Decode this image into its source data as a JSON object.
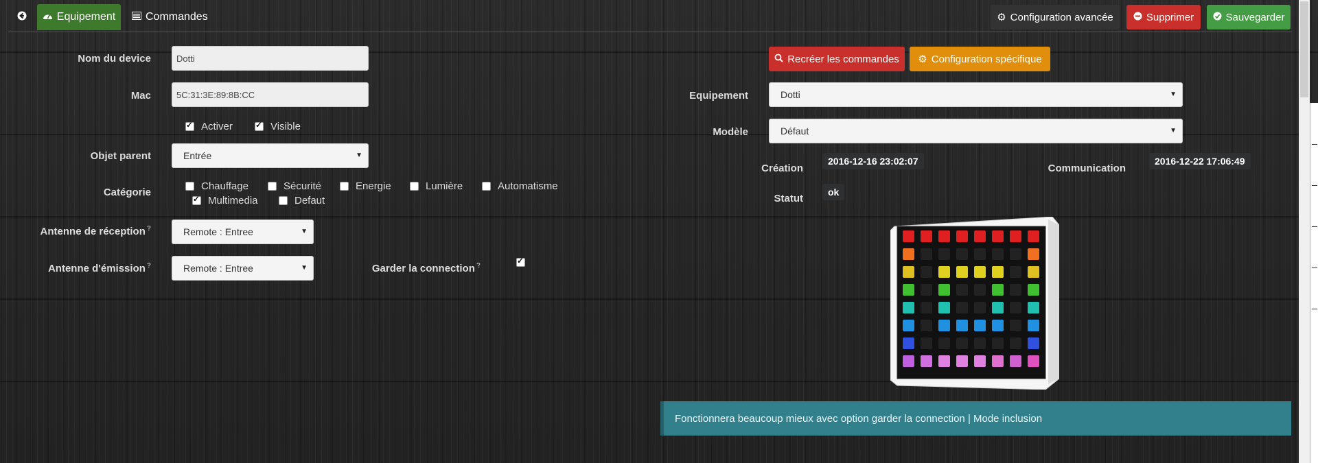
{
  "tabs": {
    "back_icon": "circle-arrow-left-icon",
    "equipement": "Equipement",
    "commandes": "Commandes"
  },
  "toolbar": {
    "advanced_config": "Configuration avancée",
    "delete": "Supprimer",
    "save": "Sauvegarder"
  },
  "actions": {
    "recreate": "Recréer les commandes",
    "specific_config": "Configuration spécifique"
  },
  "form": {
    "device_name_label": "Nom du device",
    "device_name_value": "Dotti",
    "mac_label": "Mac",
    "mac_value": "5C:31:3E:89:8B:CC",
    "activate_label": "Activer",
    "activate_checked": true,
    "visible_label": "Visible",
    "visible_checked": true,
    "parent_label": "Objet parent",
    "parent_value": "Entrée",
    "category_label": "Catégorie",
    "categories": [
      {
        "label": "Chauffage",
        "checked": false
      },
      {
        "label": "Sécurité",
        "checked": false
      },
      {
        "label": "Energie",
        "checked": false
      },
      {
        "label": "Lumière",
        "checked": false
      },
      {
        "label": "Automatisme",
        "checked": false
      },
      {
        "label": "Multimedia",
        "checked": true
      },
      {
        "label": "Defaut",
        "checked": false
      }
    ],
    "rx_antenna_label": "Antenne de réception",
    "rx_antenna_value": "Remote : Entree",
    "tx_antenna_label": "Antenne d'émission",
    "tx_antenna_value": "Remote : Entree",
    "keep_connection_label": "Garder la connection",
    "keep_connection_checked": true
  },
  "right": {
    "equipment_label": "Equipement",
    "equipment_value": "Dotti",
    "model_label": "Modèle",
    "model_value": "Défaut",
    "creation_label": "Création",
    "creation_value": "2016-12-16 23:02:07",
    "communication_label": "Communication",
    "communication_value": "2016-12-22 17:06:49",
    "status_label": "Statut",
    "status_value": "ok"
  },
  "alert": {
    "text": "Fonctionnera beaucoup mieux avec option garder la connection | Mode inclusion"
  },
  "colors": {
    "equip_tab": "#3d7a2c",
    "danger": "#c9302c",
    "success": "#449d44",
    "warning": "#e08e0b",
    "info": "#31808c"
  }
}
